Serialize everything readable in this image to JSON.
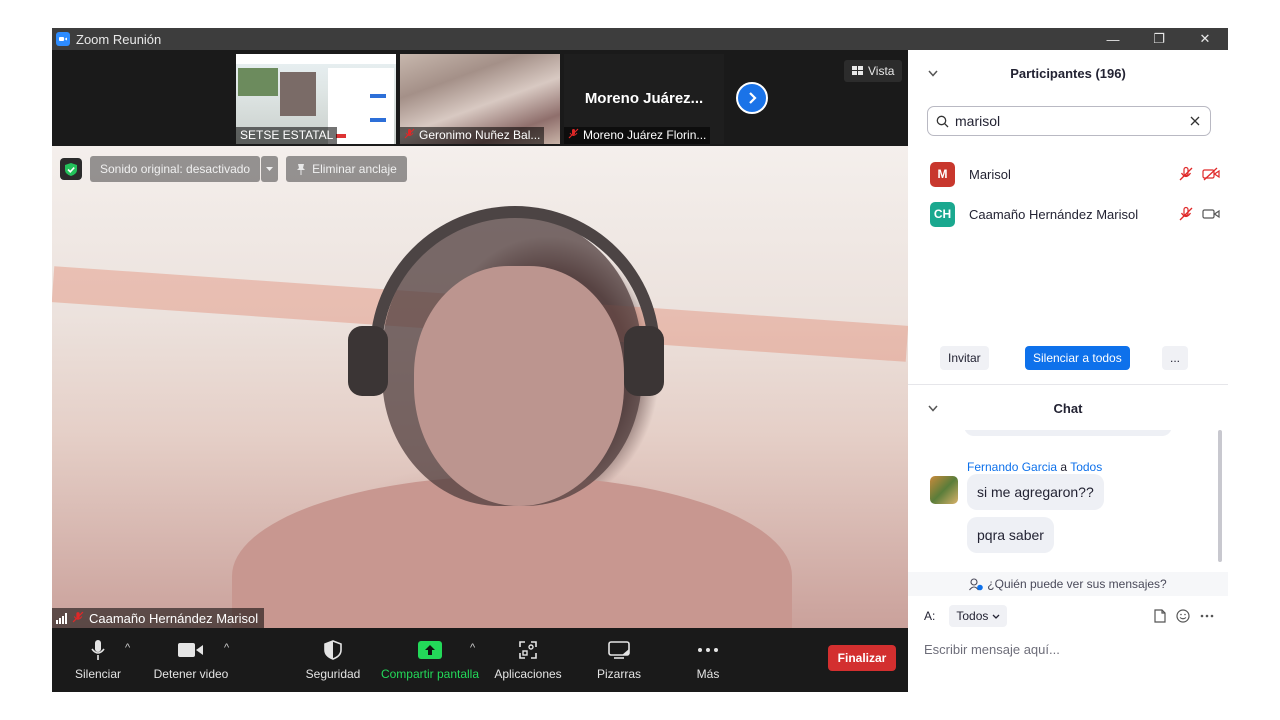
{
  "window": {
    "title": "Zoom Reunión",
    "controls": [
      "—",
      "❐",
      "✕"
    ]
  },
  "meeting": {
    "thumbnails": [
      {
        "name": "SETSE ESTATAL",
        "muted": false
      },
      {
        "name": "Geronimo Nuñez Bal...",
        "muted": true
      },
      {
        "name": "Moreno Juárez Florin...",
        "display_name": "Moreno  Juárez...",
        "muted": true
      }
    ],
    "view_label": "Vista",
    "original_sound_label": "Sonido original: desactivado",
    "unpin_label": "Eliminar anclaje",
    "active_speaker": "Caamaño Hernández Marisol",
    "toolbar": {
      "mute": "Silenciar",
      "stop_video": "Detener video",
      "security": "Seguridad",
      "share_screen": "Compartir pantalla",
      "apps": "Aplicaciones",
      "whiteboards": "Pizarras",
      "more": "Más",
      "end": "Finalizar"
    }
  },
  "participants": {
    "header": "Participantes (196)",
    "search_value": "marisol",
    "list": [
      {
        "initials": "M",
        "name": "Marisol",
        "color": "#c8372d",
        "audio_muted": true,
        "video_off": true
      },
      {
        "initials": "CH",
        "name": "Caamaño Hernández Marisol",
        "color": "#1aa88f",
        "audio_muted": true,
        "video_off": false
      }
    ],
    "invite": "Invitar",
    "mute_all": "Silenciar a todos",
    "more": "..."
  },
  "chat": {
    "header": "Chat",
    "sender_name": "Fernando Garcia",
    "sender_to_word": "a",
    "sender_target": "Todos",
    "messages": [
      "si me agregaron??",
      "pqra saber"
    ],
    "who_can_see": "¿Quién puede ver sus mensajes?",
    "to_label": "A:",
    "to_value": "Todos",
    "placeholder": "Escribir mensaje aquí..."
  },
  "colors": {
    "accent": "#0e71eb",
    "end": "#d32f2f",
    "share": "#23d959",
    "muted_red": "#e02828"
  }
}
